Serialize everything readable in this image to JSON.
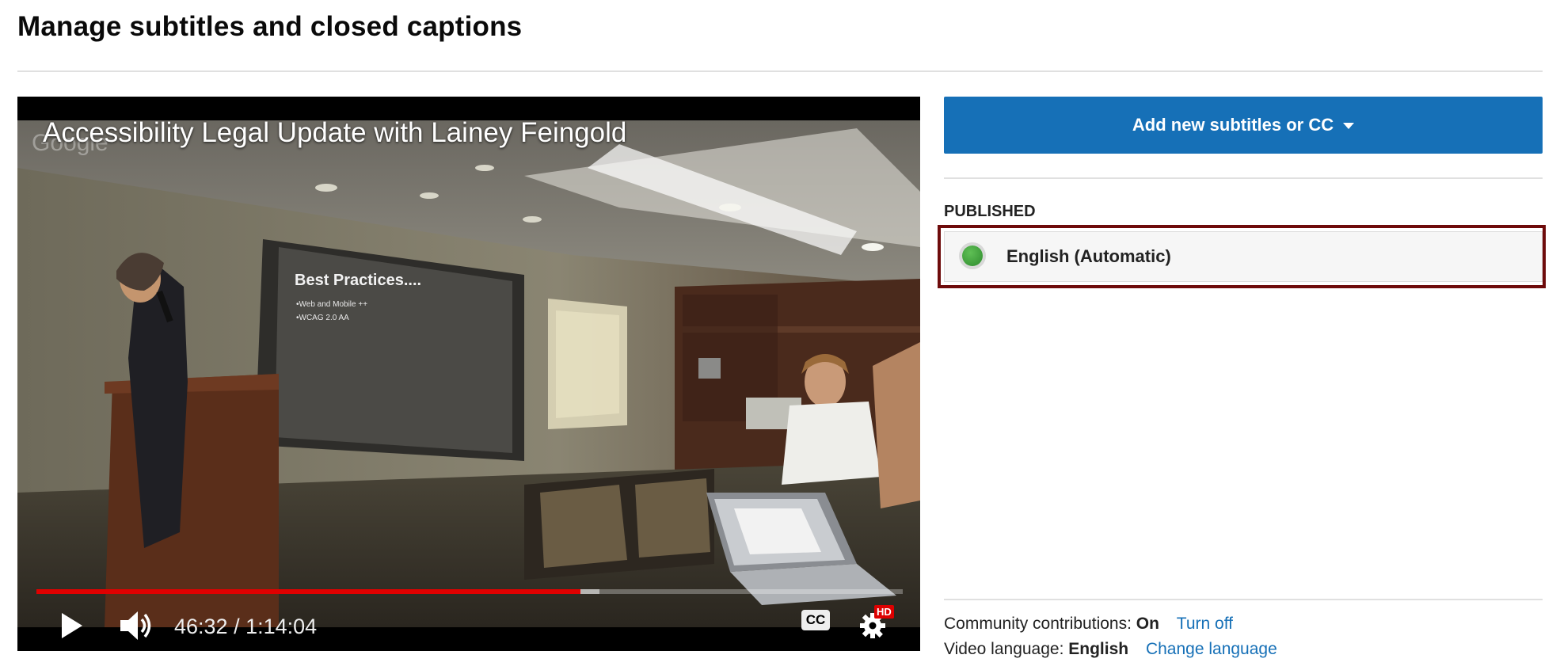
{
  "page": {
    "title": "Manage subtitles and closed captions"
  },
  "player": {
    "video_title": "Accessibility Legal Update with Lainey Feingold",
    "watermark": "Google",
    "time": "46:32 / 1:14:04",
    "played_fraction": 0.628,
    "buffered_fraction": 0.65,
    "cc_label": "CC",
    "hd_label": "HD",
    "slide_title": "Best Practices....",
    "slide_bullets": [
      "•Web and Mobile ++",
      "•WCAG 2.0 AA"
    ]
  },
  "panel": {
    "add_button_label": "Add new subtitles or CC",
    "published_heading": "PUBLISHED",
    "tracks": [
      {
        "label": "English (Automatic)",
        "status": "published"
      }
    ],
    "community_label": "Community contributions:",
    "community_value": "On",
    "community_link": "Turn off",
    "language_label": "Video language:",
    "language_value": "English",
    "language_link": "Change language"
  },
  "colors": {
    "accent": "#1670b7",
    "highlight_border": "#6e0b0b",
    "progress": "#e00000",
    "status_green": "#3a9b3a"
  }
}
